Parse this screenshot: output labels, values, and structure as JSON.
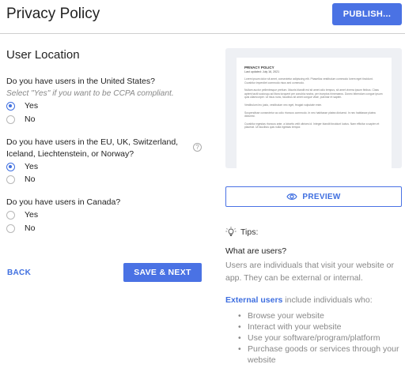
{
  "header": {
    "title": "Privacy Policy",
    "publish_label": "PUBLISH..."
  },
  "form": {
    "section_title": "User Location",
    "questions": [
      {
        "label": "Do you have users in the United States?",
        "hint": "Select \"Yes\" if you want to be CCPA compliant.",
        "options": [
          "Yes",
          "No"
        ],
        "selected": "Yes"
      },
      {
        "label_line1": "Do you have users in the EU, UK, Switzerland,",
        "label_line2": "Iceland, Liechtenstein, or Norway?",
        "options": [
          "Yes",
          "No"
        ],
        "selected": "Yes"
      },
      {
        "label": "Do you have users in Canada?",
        "options": [
          "Yes",
          "No"
        ],
        "selected": null
      }
    ],
    "help_glyph": "?",
    "back_label": "BACK",
    "save_label": "SAVE & NEXT"
  },
  "preview": {
    "doc_title": "PRIVACY POLICY",
    "doc_date": "Last updated: July 16, 2021",
    "paragraphs": [
      "Lorem ipsum dolor sit amet, consectetur adipiscing elit. Phasellus vestibulum commodo lorem eget tincidunt. Curabitur imperdiet commodo risus sed commodo.",
      "Nullam auctor pellentesque pretium. Mauris blandit est sit amet odio tempus, sit amet viverra ipsum finibus. Class aptent taciti sociosqu ad litora torquent per conubia nostra, per inceptos himenaeos. Donec bibendum congue ipsum quis ullamcorper. Ut risus nunc, faucibus sit amet congue vitae, pulvinar et sapien.",
      "Vestibulum leo justo, vestibulum nec eget, feugiat vulputate enim.",
      "Suspendisse consectetur ac odio rhoncus commodo. In nec habitasse platea dictumst. In nec habitasse platea dictumst.",
      "Curabitur egestas rhoncus ante, a lobortis velit ultrices id. Integer blandit tincidunt luctus. Nam efficitur a sapien et placerat. Ut faucibus quis nulla egestas tempor."
    ],
    "button_label": "PREVIEW"
  },
  "tips": {
    "heading": "Tips:",
    "question": "What are users?",
    "answer": "Users are individuals that visit your website or app. They can be external or internal.",
    "external_bold": "External users",
    "external_rest": " include individuals who:",
    "bullets": [
      "Browse your website",
      "Interact with your website",
      "Use your software/program/platform",
      "Purchase goods or services through your website"
    ]
  },
  "colors": {
    "accent": "#4a72e4",
    "link": "#3f6fe0"
  }
}
